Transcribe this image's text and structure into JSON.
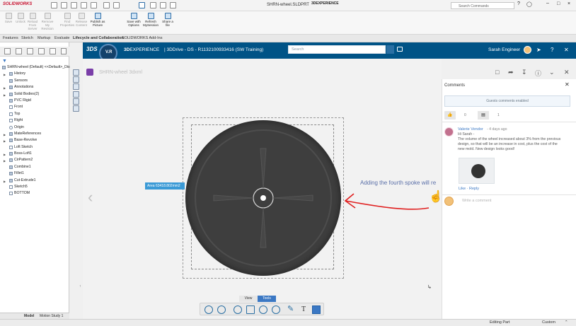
{
  "app": {
    "brand": "SOLIDWORKS",
    "doc_title": "SHRN-wheel.SLDPRT",
    "search_commands_placeholder": "Search Commands"
  },
  "ribbon": {
    "buttons": [
      {
        "label": "Save"
      },
      {
        "label": "Unlock"
      },
      {
        "label": "Reload From Server"
      },
      {
        "label": "Remove My Revision"
      },
      {
        "label": "Find Properties"
      },
      {
        "label": "Release Content"
      },
      {
        "label": "Publish as Picture"
      },
      {
        "label": "Save with Options"
      },
      {
        "label": "Refresh MySession"
      },
      {
        "label": "Share a file"
      }
    ]
  },
  "tabs": [
    {
      "label": "Features"
    },
    {
      "label": "Sketch"
    },
    {
      "label": "Markup"
    },
    {
      "label": "Evaluate"
    },
    {
      "label": "Lifecycle and Collaboration"
    },
    {
      "label": "SOLIDWORKS Add-Ins"
    }
  ],
  "tabs_right_label": "3DEXPERIENCE",
  "feature_tree": {
    "root": "SHRN-wheel (Default) <<Default>_Dis",
    "items": [
      {
        "label": "History"
      },
      {
        "label": "Sensors"
      },
      {
        "label": "Annotations"
      },
      {
        "label": "Solid Bodies(2)"
      },
      {
        "label": "PVC Rigid"
      },
      {
        "label": "Front"
      },
      {
        "label": "Top"
      },
      {
        "label": "Right"
      },
      {
        "label": "Origin"
      },
      {
        "label": "MateReferences"
      },
      {
        "label": "Base-Revolve"
      },
      {
        "label": "Loft Sketch"
      },
      {
        "label": "Boss-Loft1"
      },
      {
        "label": "CirPattern2"
      },
      {
        "label": "Combine1"
      },
      {
        "label": "Fillet1"
      },
      {
        "label": "Cut-Extrude1"
      },
      {
        "label": "Sketch5"
      },
      {
        "label": "BOTTOM"
      }
    ]
  },
  "bottom_tabs": [
    {
      "label": "Model"
    },
    {
      "label": "Motion Study 1"
    }
  ],
  "xp": {
    "brand_bold": "3D",
    "brand_rest": "EXPERIENCE",
    "context": "| 3DDrive - DS - R1132100933416 (SW Training)",
    "search_placeholder": "Search",
    "user_name": "Sarah Engineer"
  },
  "viewer": {
    "doc_name": "SHRN-wheel 3dxml",
    "area_label": "Area 63418.802mm2",
    "annotation_text": "Adding the fourth spoke will re",
    "view_tab": "View",
    "tools_tab": "Tools"
  },
  "comments": {
    "title": "Comments",
    "guest_banner": "Guests comments enabled",
    "like_count": "0",
    "comment_count": "1",
    "author": "Valerie Vendor",
    "time": "- 4 days ago",
    "body_line1": "Hi Sarah -",
    "body_rest": "The volume of the wheel increased about 3% from the previous design, so that will be an increase in cost, plus the cost of the new mold. New design looks good!",
    "actions": "Like · Reply",
    "write_placeholder": "Write a comment"
  },
  "status": {
    "mode": "Editing Part",
    "units": "Custom"
  },
  "colors": {
    "xp_header": "#005386",
    "link_blue": "#3b78c4",
    "annotation_red": "#e02020"
  }
}
